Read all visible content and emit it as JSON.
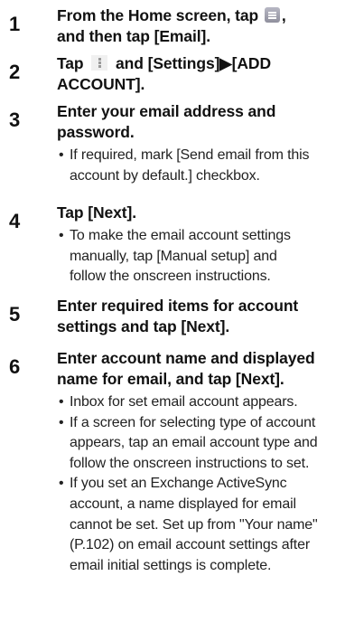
{
  "steps": [
    {
      "number": "1",
      "heading_parts": [
        "From the Home screen, tap ",
        ",",
        "and then tap [Email]."
      ],
      "icon": "app-list-icon",
      "bullets": []
    },
    {
      "number": "2",
      "heading_parts": [
        "Tap ",
        " and [Settings]▶[ADD",
        "ACCOUNT]."
      ],
      "icon": "overflow-menu-icon",
      "bullets": []
    },
    {
      "number": "3",
      "heading_lines": [
        "Enter your email address and",
        "password."
      ],
      "bullets": [
        [
          "If required, mark [Send email from this",
          "account by default.] checkbox."
        ]
      ]
    },
    {
      "number": "4",
      "heading_lines": [
        "Tap [Next]."
      ],
      "bullets": [
        [
          "To make the email account settings",
          "manually, tap [Manual setup] and",
          "follow the onscreen instructions."
        ]
      ]
    },
    {
      "number": "5",
      "heading_lines": [
        "Enter required items for account",
        "settings and tap [Next]."
      ],
      "bullets": []
    },
    {
      "number": "6",
      "heading_lines": [
        "Enter account name and displayed",
        "name for email, and tap [Next]."
      ],
      "bullets": [
        [
          "Inbox for set email account appears."
        ],
        [
          "If a screen for selecting type of account",
          "appears, tap an email account type and",
          "follow the onscreen instructions to set."
        ],
        [
          "If you set an Exchange ActiveSync",
          "account, a name displayed for email",
          "cannot be set. Set up from \"Your name\"",
          "(P.102) on email account settings after",
          "email initial settings is complete."
        ]
      ]
    }
  ],
  "bullet_char": "•"
}
